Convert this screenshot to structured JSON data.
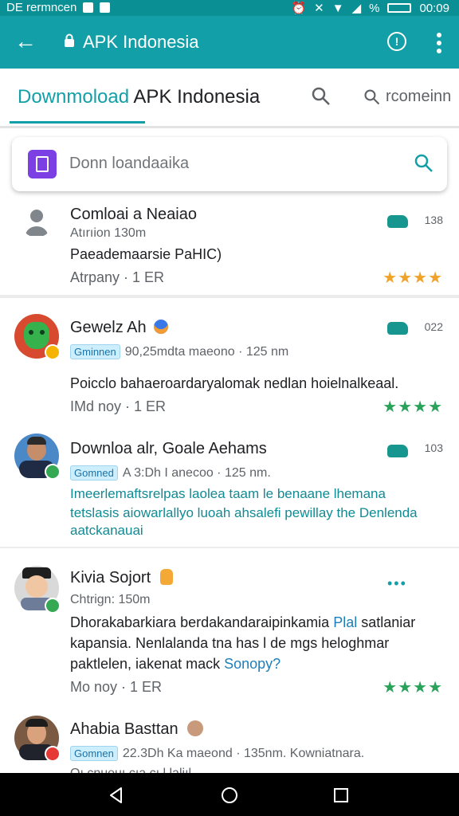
{
  "status_bar": {
    "left_text": "DE rermncen",
    "time": "00:09",
    "percent": "%"
  },
  "app_bar": {
    "title": "APK Indonesia"
  },
  "tabs": {
    "tab1_part1": "Downmoload",
    "tab1_part2": "APK Indonesia",
    "tab3_label": "rcomeinn"
  },
  "search": {
    "placeholder": "Donn loandaaika"
  },
  "items": [
    {
      "name": "Comloai a Neaiao",
      "meta": "Atırıion 130m",
      "desc": "Paeademaarsie PaHIC)",
      "footer": "Atrpany · 1 ER",
      "num": "138",
      "stars": "★★★★"
    },
    {
      "name": "Gewelz Ah",
      "chip": "Gminnen",
      "meta": "90,25mdta maeono · 125 nm",
      "desc": "Poicclo bahaeroardaryalomak nedlan hoielnalkeaal.",
      "footer": "IMd noy · 1 ER",
      "num": "022",
      "stars": "★★★★"
    },
    {
      "name": "Downloa alr, Goale Aehams",
      "chip": "Gomned",
      "meta": "A 3:Dh I anecoo · 125 nm.",
      "desc_lines": [
        "Imeerlemaftsrelpas laolea taam le benaane lhemana",
        "tetslasis aiowarlallyo luoah ahsalefi pewillay the Denlenda",
        "aatckanauai"
      ],
      "num": "103"
    },
    {
      "name": "Kivia Sojort",
      "meta": "Chtrign: 150m",
      "desc_line1_a": "Dhorakabarkiara berdakandaraipinkamia",
      "desc_line1_b": "Plal",
      "desc_line1_c": "satlaniar",
      "desc_line2": "kapansia. Nenlalanda tna has l de mgs heloghmar",
      "desc_line3_a": "paktlelen, iakenat mack",
      "desc_line3_b": "Sonopy?",
      "footer": "Mo noy · 1 ER",
      "dots": "•••",
      "stars": "★★★★"
    },
    {
      "name": "Ahabia Basttan",
      "chip": "Gomnen",
      "meta": "22.3Dh Ka maeond · 135nm. Kowniatnara.",
      "partial": "Oı cnueuı cıa cı l.laliıl"
    }
  ],
  "colors": {
    "teal": "#139fa7",
    "status": "#0a8f95",
    "star_gold": "#f0a32a",
    "star_green": "#2aa35a"
  }
}
